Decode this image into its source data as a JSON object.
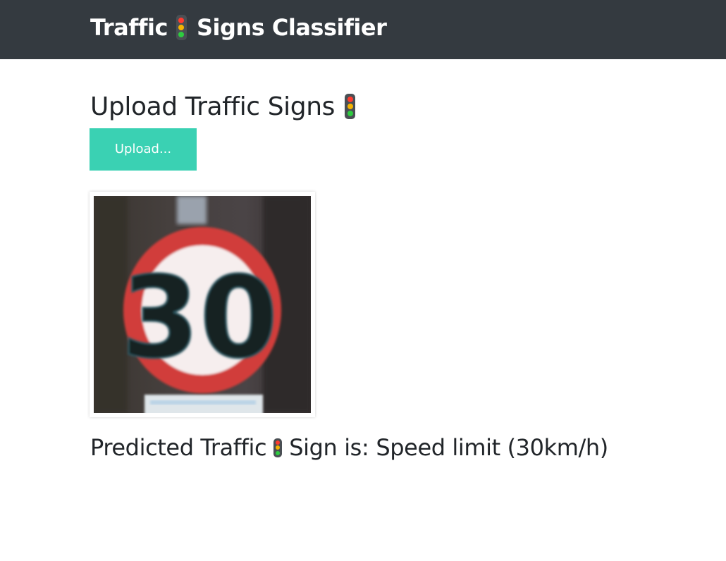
{
  "navbar": {
    "brand_part1": "Traffic",
    "brand_part2": "Signs Classifier"
  },
  "upload": {
    "heading": "Upload Traffic Signs",
    "button_label": "Upload..."
  },
  "uploaded_image": {
    "sign_text": "30"
  },
  "prediction": {
    "prefix": "Predicted Traffic",
    "middle": "Sign is:",
    "result": "Speed limit (30km/h)"
  },
  "colors": {
    "navbar_bg": "#343a40",
    "button_bg": "#3ad1b3",
    "sign_red": "#d13c3a",
    "text": "#212529"
  },
  "icons": [
    "traffic-light-icon"
  ]
}
